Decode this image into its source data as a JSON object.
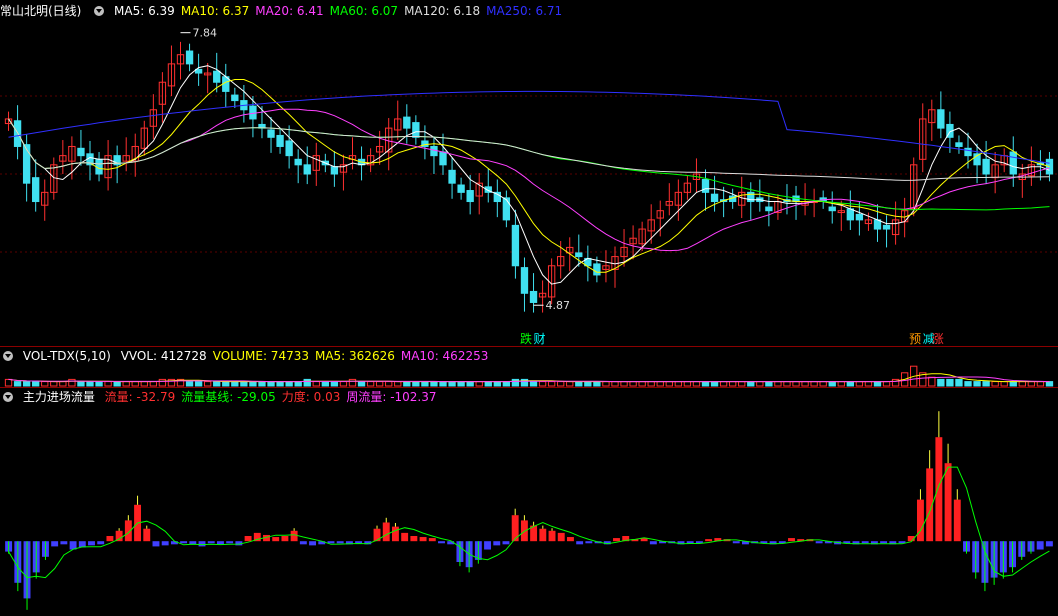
{
  "main": {
    "stock_name": "常山北明(日线)",
    "ma_labels": [
      {
        "text": "MA5: 6.39",
        "color": "#ffffff"
      },
      {
        "text": "MA10: 6.37",
        "color": "#ffff00"
      },
      {
        "text": "MA20: 6.41",
        "color": "#ff40ff"
      },
      {
        "text": "MA60: 6.07",
        "color": "#00ff00"
      },
      {
        "text": "MA120: 6.18",
        "color": "#dddddd"
      },
      {
        "text": "MA250: 6.71",
        "color": "#3030ff"
      }
    ],
    "high_label": "7.84",
    "low_label": "4.87",
    "markers": [
      {
        "text": "跌",
        "color": "#00ff00"
      },
      {
        "text": "财",
        "color": "#00ffff"
      },
      {
        "text": "预",
        "color": "#ff9900"
      },
      {
        "text": "减",
        "color": "#00ffff"
      },
      {
        "text": "涨",
        "color": "#ff3030"
      }
    ]
  },
  "vol": {
    "name": "VOL-TDX(5,10)",
    "labels": [
      {
        "text": "VVOL: 412728",
        "color": "#ffffff"
      },
      {
        "text": "VOLUME: 74733",
        "color": "#ffff00"
      },
      {
        "text": "MA5: 362626",
        "color": "#ffff00"
      },
      {
        "text": "MA10: 462253",
        "color": "#ff40ff"
      }
    ]
  },
  "flow": {
    "name": "主力进场流量",
    "labels": [
      {
        "text": "流量: -32.79",
        "color": "#ff3030"
      },
      {
        "text": "流量基线: -29.05",
        "color": "#00ff00"
      },
      {
        "text": "力度: 0.03",
        "color": "#ff3030"
      },
      {
        "text": "周流量: -102.37",
        "color": "#ff40ff"
      }
    ]
  },
  "chart_data": [
    {
      "type": "candlestick",
      "y_range": [
        4.6,
        8.0
      ],
      "annotations": [
        {
          "text": "7.84",
          "value": 7.84
        },
        {
          "text": "4.87",
          "value": 4.87
        }
      ],
      "closes": [
        6.9,
        6.6,
        6.2,
        6.0,
        6.1,
        6.4,
        6.5,
        6.6,
        6.5,
        6.4,
        6.3,
        6.5,
        6.4,
        6.5,
        6.6,
        6.8,
        7.0,
        7.3,
        7.5,
        7.6,
        7.5,
        7.4,
        7.4,
        7.3,
        7.2,
        7.1,
        7.0,
        6.9,
        6.8,
        6.7,
        6.6,
        6.5,
        6.4,
        6.3,
        6.5,
        6.4,
        6.3,
        6.4,
        6.5,
        6.4,
        6.5,
        6.6,
        6.8,
        6.9,
        6.8,
        6.7,
        6.6,
        6.5,
        6.4,
        6.2,
        6.1,
        6.0,
        6.2,
        6.1,
        6.0,
        5.8,
        5.3,
        5.0,
        4.9,
        5.0,
        5.3,
        5.4,
        5.5,
        5.4,
        5.3,
        5.2,
        5.3,
        5.4,
        5.5,
        5.6,
        5.7,
        5.8,
        5.9,
        6.0,
        6.1,
        6.2,
        6.3,
        6.1,
        6.0,
        6.0,
        6.0,
        6.1,
        6.0,
        6.0,
        5.9,
        6.0,
        6.0,
        6.0,
        6.0,
        6.0,
        6.0,
        5.9,
        5.9,
        5.8,
        5.8,
        5.8,
        5.7,
        5.7,
        5.8,
        5.9,
        6.4,
        6.9,
        7.0,
        6.8,
        6.7,
        6.6,
        6.5,
        6.4,
        6.3,
        6.4,
        6.5,
        6.3,
        6.3,
        6.4,
        6.4,
        6.3
      ]
    },
    {
      "type": "bar",
      "name": "VOL-TDX(5,10)",
      "values": [
        3,
        2,
        2,
        2,
        2,
        2,
        2,
        3,
        2,
        2,
        2,
        2,
        2,
        2,
        2,
        2,
        2,
        3,
        3,
        3,
        2,
        2,
        2,
        2,
        2,
        2,
        2,
        2,
        2,
        2,
        2,
        2,
        2,
        3,
        2,
        2,
        2,
        2,
        3,
        2,
        2,
        2,
        2,
        2,
        2,
        2,
        2,
        2,
        2,
        2,
        2,
        2,
        2,
        2,
        2,
        2,
        3,
        3,
        2,
        2,
        2,
        2,
        2,
        2,
        2,
        2,
        2,
        2,
        2,
        2,
        2,
        2,
        2,
        2,
        2,
        2,
        2,
        2,
        2,
        2,
        2,
        2,
        2,
        2,
        2,
        2,
        2,
        2,
        2,
        2,
        2,
        2,
        2,
        2,
        2,
        2,
        2,
        2,
        3,
        6,
        9,
        6,
        4,
        3,
        3,
        3,
        2,
        2,
        2,
        2,
        2,
        2,
        2,
        2,
        2,
        2
      ]
    },
    {
      "type": "bar",
      "name": "主力进场流量",
      "y_range": [
        -70,
        130
      ],
      "values": [
        -10,
        -40,
        -55,
        -30,
        -15,
        -5,
        -3,
        -8,
        -6,
        -4,
        -3,
        5,
        10,
        20,
        35,
        12,
        -5,
        -4,
        -3,
        -2,
        -3,
        -5,
        -2,
        -3,
        -2,
        -4,
        5,
        8,
        6,
        4,
        5,
        10,
        -3,
        -4,
        -3,
        -2,
        -2,
        -3,
        -2,
        -3,
        12,
        18,
        14,
        8,
        5,
        4,
        3,
        -2,
        -3,
        -20,
        -25,
        -18,
        -8,
        -4,
        -3,
        25,
        20,
        15,
        12,
        10,
        8,
        4,
        -3,
        -2,
        -2,
        -3,
        3,
        5,
        2,
        3,
        -3,
        -2,
        -2,
        -3,
        -2,
        -2,
        2,
        3,
        2,
        -2,
        -3,
        -2,
        -2,
        -3,
        -2,
        3,
        2,
        2,
        -2,
        -2,
        -3,
        -2,
        -3,
        -2,
        -3,
        -2,
        -3,
        -2,
        5,
        40,
        70,
        100,
        75,
        40,
        -10,
        -30,
        -40,
        -35,
        -30,
        -25,
        -15,
        -10,
        -8,
        -5
      ]
    }
  ]
}
